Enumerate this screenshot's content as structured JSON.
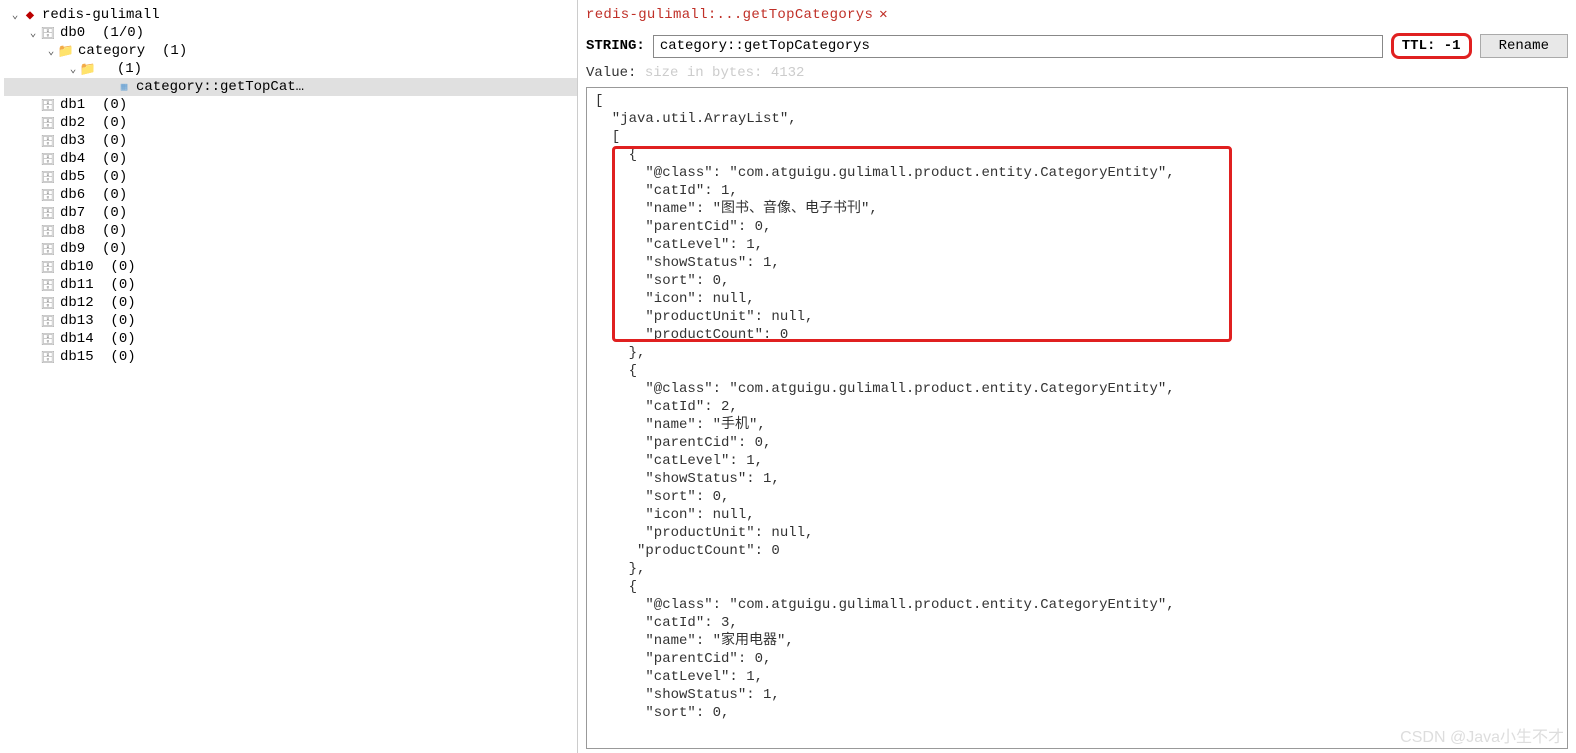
{
  "tree": {
    "root": {
      "label": "redis-gulimall"
    },
    "db0": {
      "label": "db0",
      "count": "(1/0)"
    },
    "category": {
      "label": "category",
      "count": "(1)"
    },
    "sub": {
      "label": "(1)"
    },
    "key": {
      "label": "category::getTopCat…"
    },
    "dbs": [
      {
        "label": "db1",
        "count": "(0)"
      },
      {
        "label": "db2",
        "count": "(0)"
      },
      {
        "label": "db3",
        "count": "(0)"
      },
      {
        "label": "db4",
        "count": "(0)"
      },
      {
        "label": "db5",
        "count": "(0)"
      },
      {
        "label": "db6",
        "count": "(0)"
      },
      {
        "label": "db7",
        "count": "(0)"
      },
      {
        "label": "db8",
        "count": "(0)"
      },
      {
        "label": "db9",
        "count": "(0)"
      },
      {
        "label": "db10",
        "count": "(0)"
      },
      {
        "label": "db11",
        "count": "(0)"
      },
      {
        "label": "db12",
        "count": "(0)"
      },
      {
        "label": "db13",
        "count": "(0)"
      },
      {
        "label": "db14",
        "count": "(0)"
      },
      {
        "label": "db15",
        "count": "(0)"
      }
    ]
  },
  "tab": {
    "title": "redis-gulimall:...getTopCategorys"
  },
  "meta": {
    "type_label": "STRING:",
    "key_value": "category::getTopCategorys",
    "ttl_label": "TTL: -1",
    "rename_btn": "Rename",
    "value_label": "Value:",
    "size_label": "size in bytes: 4132"
  },
  "value_text": "[\n  \"java.util.ArrayList\",\n  [\n    {\n      \"@class\": \"com.atguigu.gulimall.product.entity.CategoryEntity\",\n      \"catId\": 1,\n      \"name\": \"图书、音像、电子书刊\",\n      \"parentCid\": 0,\n      \"catLevel\": 1,\n      \"showStatus\": 1,\n      \"sort\": 0,\n      \"icon\": null,\n      \"productUnit\": null,\n      \"productCount\": 0\n    },\n    {\n      \"@class\": \"com.atguigu.gulimall.product.entity.CategoryEntity\",\n      \"catId\": 2,\n      \"name\": \"手机\",\n      \"parentCid\": 0,\n      \"catLevel\": 1,\n      \"showStatus\": 1,\n      \"sort\": 0,\n      \"icon\": null,\n      \"productUnit\": null,\n     \"productCount\": 0\n    },\n    {\n      \"@class\": \"com.atguigu.gulimall.product.entity.CategoryEntity\",\n      \"catId\": 3,\n      \"name\": \"家用电器\",\n      \"parentCid\": 0,\n      \"catLevel\": 1,\n      \"showStatus\": 1,\n      \"sort\": 0,",
  "watermark": "CSDN @Java小生不才"
}
